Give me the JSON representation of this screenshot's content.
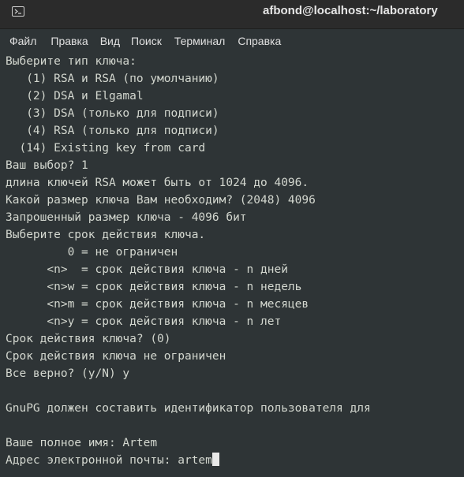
{
  "window": {
    "title": "afbond@localhost:~/laboratory"
  },
  "menu": [
    "Файл",
    "Правка",
    "Вид",
    "Поиск",
    "Терминал",
    "Справка"
  ],
  "terminal": {
    "lines": [
      "Выберите тип ключа:",
      "   (1) RSA и RSA (по умолчанию)",
      "   (2) DSA и Elgamal",
      "   (3) DSA (только для подписи)",
      "   (4) RSA (только для подписи)",
      "  (14) Existing key from card",
      "Ваш выбор? 1",
      "длина ключей RSA может быть от 1024 до 4096.",
      "Какой размер ключа Вам необходим? (2048) 4096",
      "Запрошенный размер ключа - 4096 бит",
      "Выберите срок действия ключа.",
      "         0 = не ограничен",
      "      <n>  = срок действия ключа - n дней",
      "      <n>w = срок действия ключа - n недель",
      "      <n>m = срок действия ключа - n месяцев",
      "      <n>y = срок действия ключа - n лет",
      "Срок действия ключа? (0)",
      "Срок действия ключа не ограничен",
      "Все верно? (y/N) y",
      "",
      "GnuPG должен составить идентификатор пользователя для",
      "",
      "Ваше полное имя: Artem",
      "Адрес электронной почты: artem"
    ]
  }
}
